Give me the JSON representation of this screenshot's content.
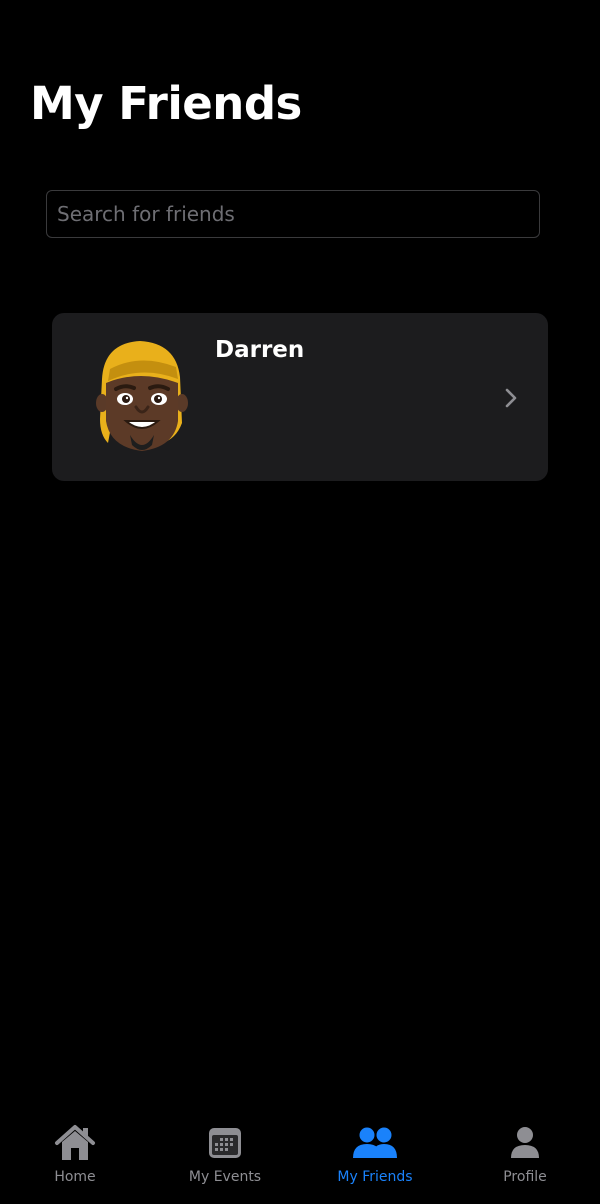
{
  "header": {
    "title": "My Friends"
  },
  "search": {
    "placeholder": "Search for friends",
    "value": ""
  },
  "friends": [
    {
      "name": "Darren",
      "avatar_icon": "memoji-avatar-icon"
    }
  ],
  "tabbar": {
    "active_color": "#1a82fb",
    "inactive_color": "#8e8e93",
    "items": [
      {
        "label": "Home",
        "icon": "house-icon",
        "active": false
      },
      {
        "label": "My Events",
        "icon": "calendar-icon",
        "active": false
      },
      {
        "label": "My Friends",
        "icon": "people-icon",
        "active": true
      },
      {
        "label": "Profile",
        "icon": "person-icon",
        "active": false
      }
    ]
  }
}
